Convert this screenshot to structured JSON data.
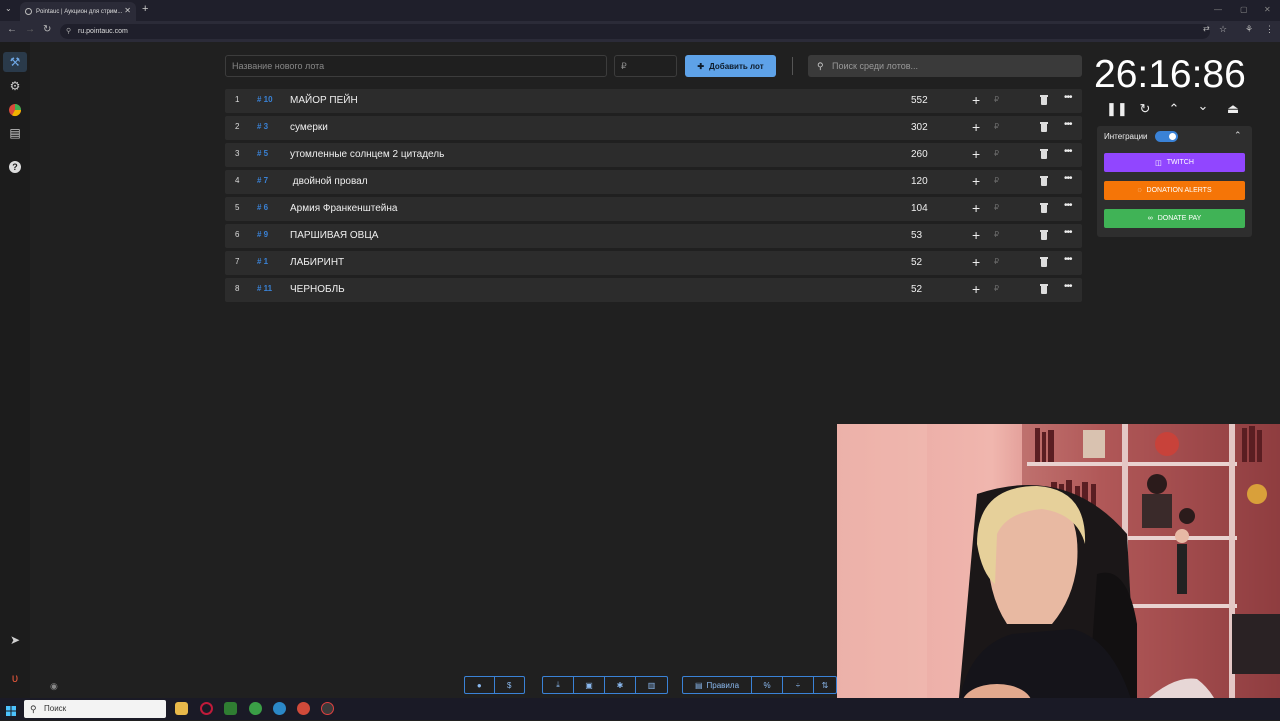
{
  "browser": {
    "tab_title": "Pointauc | Аукцион для стрим...",
    "tab_close": "✕",
    "new_tab": "+",
    "url": "ru.pointauc.com"
  },
  "form": {
    "lot_name_placeholder": "Название нового лота",
    "amount_placeholder": "₽",
    "add_lot_label": "Добавить лот",
    "search_placeholder": "Поиск среди лотов..."
  },
  "lots": [
    {
      "index": "1",
      "tag": "# 10",
      "name": "МАЙОР ПЕЙН",
      "amount": "552"
    },
    {
      "index": "2",
      "tag": "# 3",
      "name": "сумерки",
      "amount": "302"
    },
    {
      "index": "3",
      "tag": "# 5",
      "name": "утомленные солнцем 2 цитадель",
      "amount": "260"
    },
    {
      "index": "4",
      "tag": "# 7",
      "name": " двойной провал",
      "amount": "120"
    },
    {
      "index": "5",
      "tag": "# 6",
      "name": "Армия Франкенштейна",
      "amount": "104"
    },
    {
      "index": "6",
      "tag": "# 9",
      "name": "ПАРШИВАЯ ОВЦА",
      "amount": "53"
    },
    {
      "index": "7",
      "tag": "# 1",
      "name": "ЛАБИРИНТ",
      "amount": "52"
    },
    {
      "index": "8",
      "tag": "# 11",
      "name": "ЧЕРНОБЛЬ",
      "amount": "52"
    }
  ],
  "row_symbols": {
    "plus": "+",
    "rub": "₽",
    "more": "•••"
  },
  "timer": {
    "display": "26:16:86"
  },
  "integrations": {
    "label": "Интеграции",
    "twitch": "TWITCH",
    "donation_alerts": "DONATION ALERTS",
    "donate_pay": "DONATE PAY",
    "twitch_color": "#9146ff",
    "donation_alerts_color": "#f57507",
    "donate_pay_color": "#40b356"
  },
  "toolbar": {
    "rules_label": "Правила",
    "percent_label": "%",
    "dollar_label": "$"
  },
  "taskbar": {
    "search_label": "Поиск"
  },
  "icons": {
    "sidebar": [
      "gavel-icon",
      "gear-icon",
      "wheel-icon",
      "document-icon",
      "help-icon",
      "telegram-icon",
      "logo-icon"
    ]
  }
}
